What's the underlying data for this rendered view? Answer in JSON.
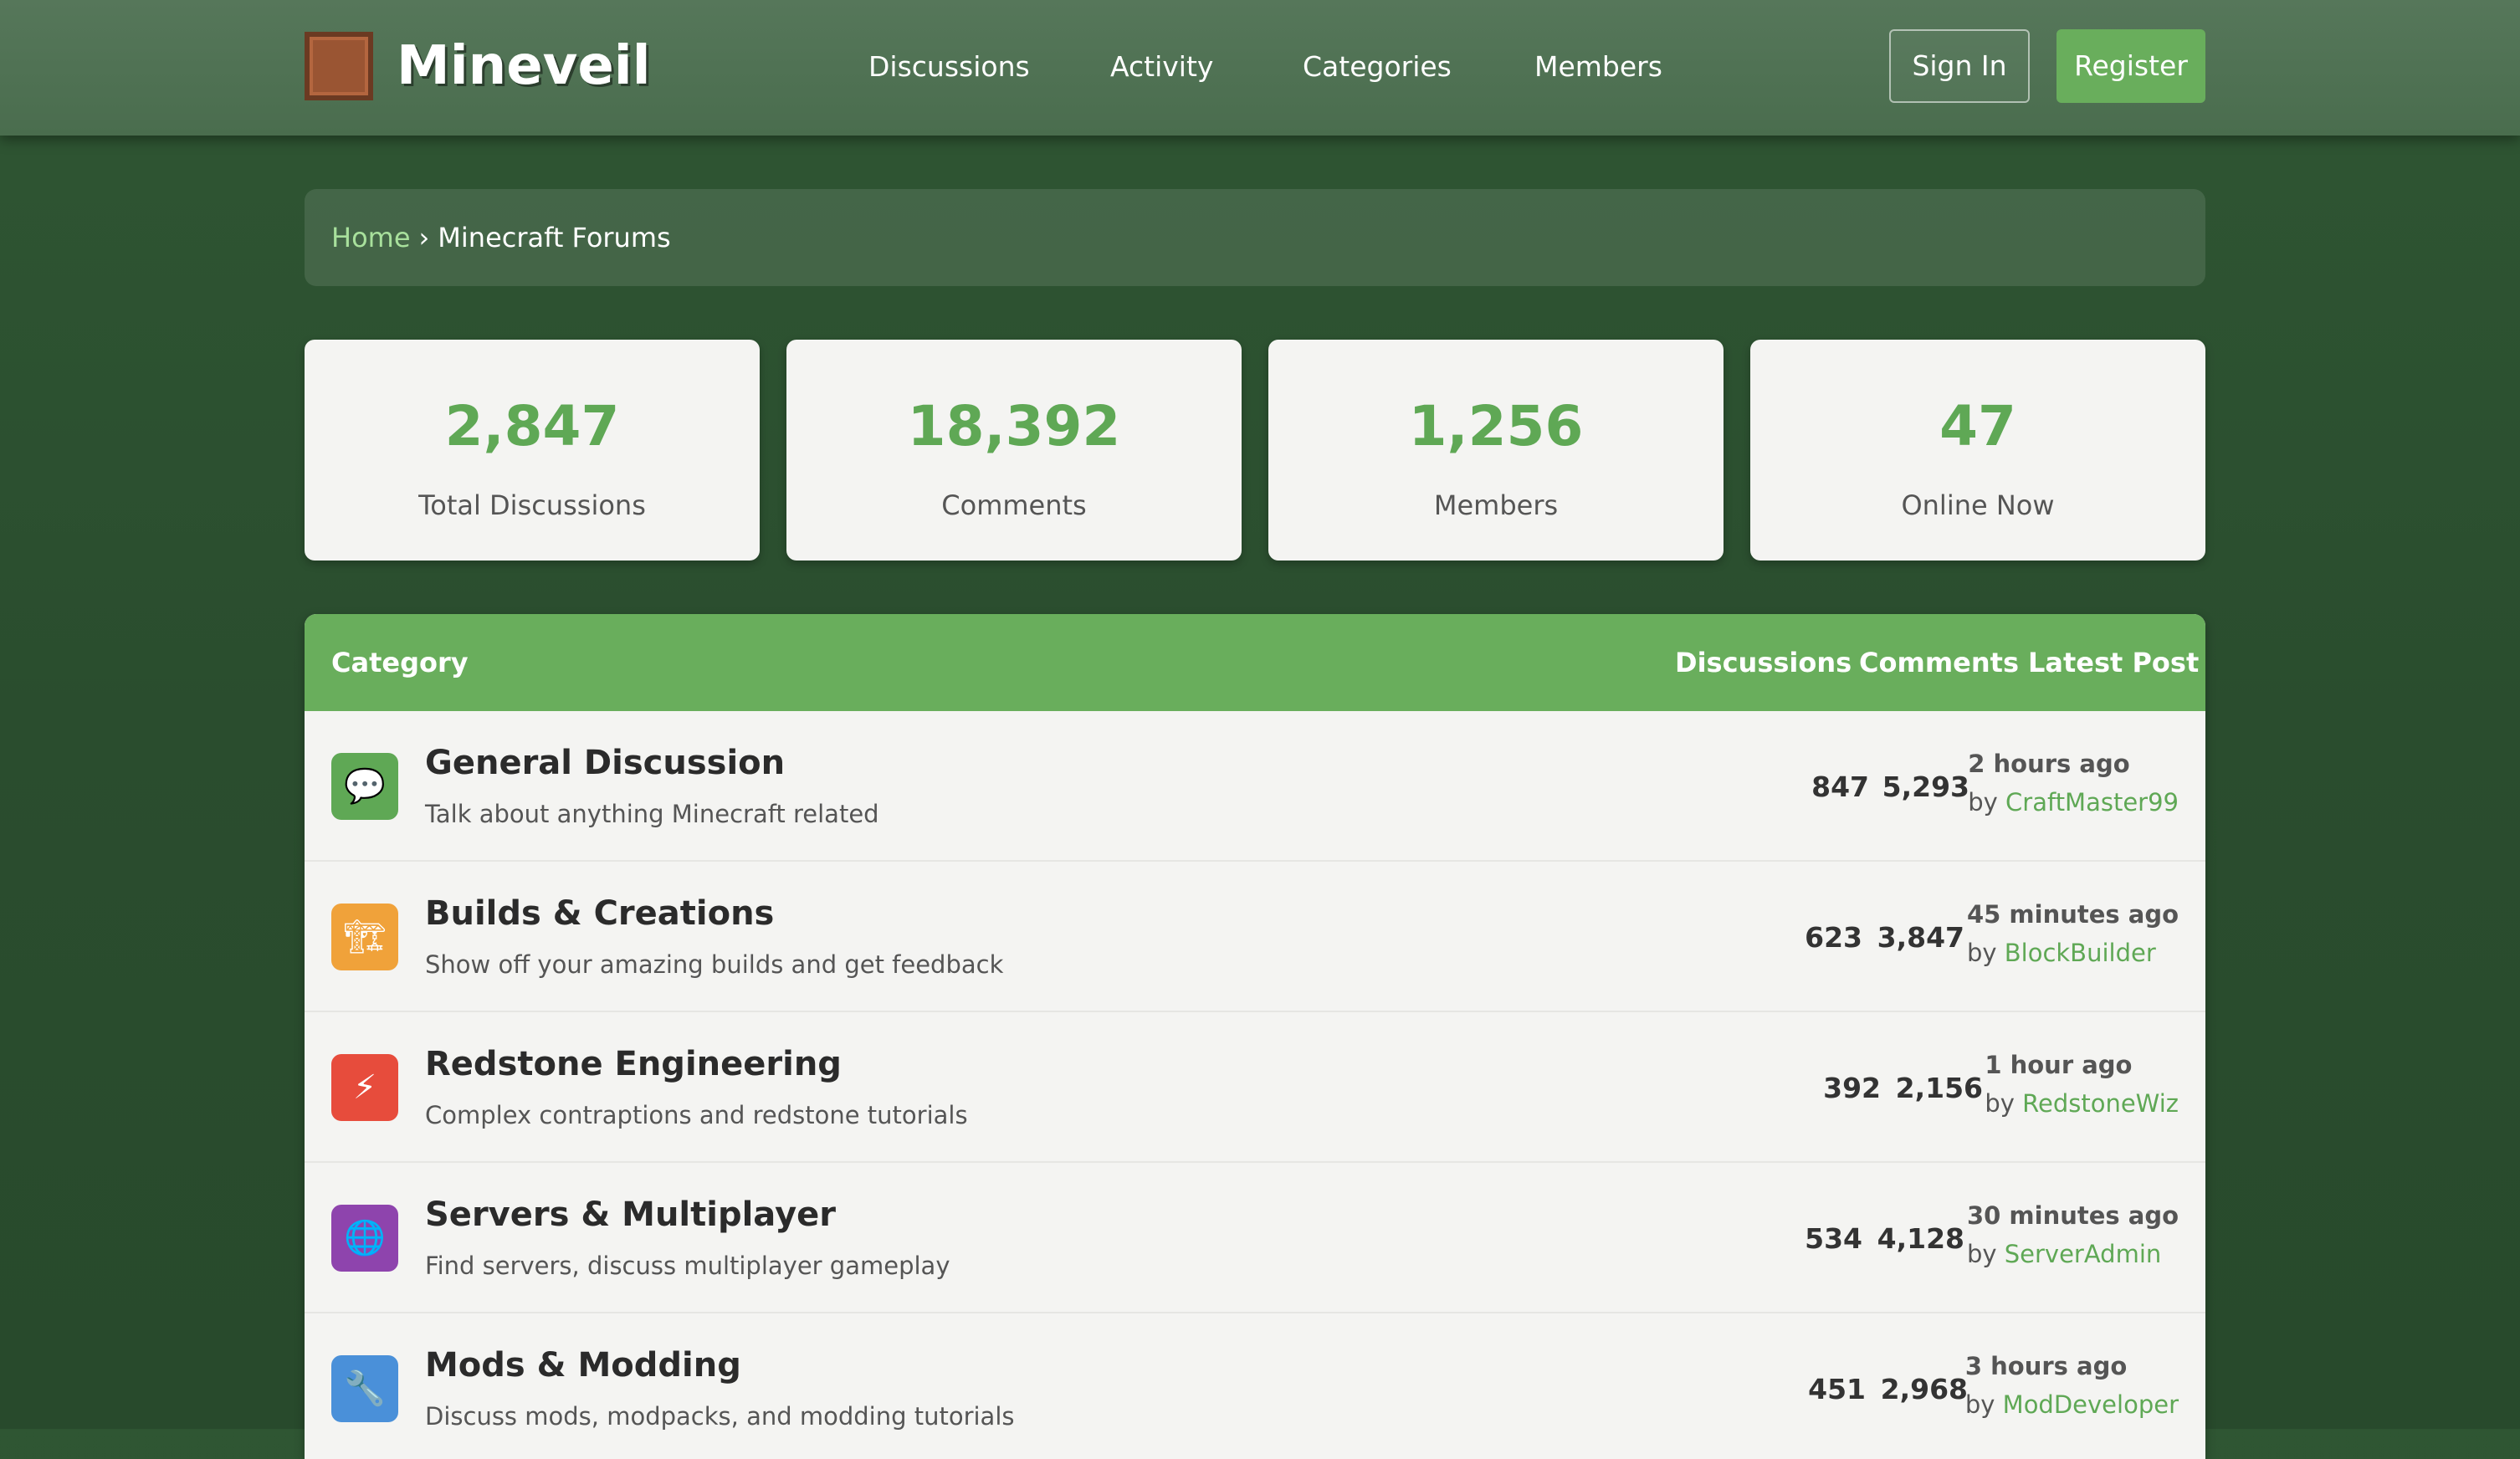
{
  "brand": {
    "name": "Mineveil"
  },
  "nav": [
    {
      "label": "Discussions"
    },
    {
      "label": "Activity"
    },
    {
      "label": "Categories"
    },
    {
      "label": "Members"
    }
  ],
  "auth": {
    "sign_in": "Sign In",
    "register": "Register"
  },
  "breadcrumb": {
    "home": "Home",
    "separator": "›",
    "current": "Minecraft Forums"
  },
  "stats": [
    {
      "value": "2,847",
      "label": "Total Discussions"
    },
    {
      "value": "18,392",
      "label": "Comments"
    },
    {
      "value": "1,256",
      "label": "Members"
    },
    {
      "value": "47",
      "label": "Online Now"
    }
  ],
  "table": {
    "headers": {
      "category": "Category",
      "discussions": "Discussions",
      "comments": "Comments",
      "latest": "Latest Post"
    },
    "rows": [
      {
        "icon": "speech-bubble-icon",
        "glyph": "💬",
        "color": "#5fa855",
        "title": "General Discussion",
        "desc": "Talk about anything Minecraft related",
        "discussions": "847",
        "comments": "5,293",
        "time": "2 hours ago",
        "by": "by",
        "user": "CraftMaster99"
      },
      {
        "icon": "construction-crane-icon",
        "glyph": "🏗",
        "color": "#f0a23a",
        "title": "Builds & Creations",
        "desc": "Show off your amazing builds and get feedback",
        "discussions": "623",
        "comments": "3,847",
        "time": "45 minutes ago",
        "by": "by",
        "user": "BlockBuilder"
      },
      {
        "icon": "lightning-bolt-icon",
        "glyph": "⚡",
        "color": "#e74c3c",
        "title": "Redstone Engineering",
        "desc": "Complex contraptions and redstone tutorials",
        "discussions": "392",
        "comments": "2,156",
        "time": "1 hour ago",
        "by": "by",
        "user": "RedstoneWiz"
      },
      {
        "icon": "globe-icon",
        "glyph": "🌐",
        "color": "#8e44ad",
        "title": "Servers & Multiplayer",
        "desc": "Find servers, discuss multiplayer gameplay",
        "discussions": "534",
        "comments": "4,128",
        "time": "30 minutes ago",
        "by": "by",
        "user": "ServerAdmin"
      },
      {
        "icon": "wrench-icon",
        "glyph": "🔧",
        "color": "#4a90d9",
        "title": "Mods & Modding",
        "desc": "Discuss mods, modpacks, and modding tutorials",
        "discussions": "451",
        "comments": "2,968",
        "time": "3 hours ago",
        "by": "by",
        "user": "ModDeveloper"
      }
    ]
  }
}
